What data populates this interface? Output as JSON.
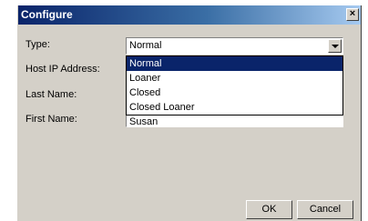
{
  "window": {
    "title": "Configure",
    "close_label": "×"
  },
  "labels": {
    "type": "Type:",
    "host_ip": "Host IP Address:",
    "last_name": "Last Name:",
    "first_name": "First Name:"
  },
  "type_select": {
    "value": "Normal",
    "options": [
      "Normal",
      "Loaner",
      "Closed",
      "Closed Loaner"
    ],
    "highlighted": "Normal"
  },
  "first_name_field": {
    "visible_value": "Susan"
  },
  "buttons": {
    "ok": "OK",
    "cancel": "Cancel"
  },
  "colors": {
    "title_gradient_start": "#0a246a",
    "face": "#d4d0c8",
    "selection": "#0a246a"
  }
}
